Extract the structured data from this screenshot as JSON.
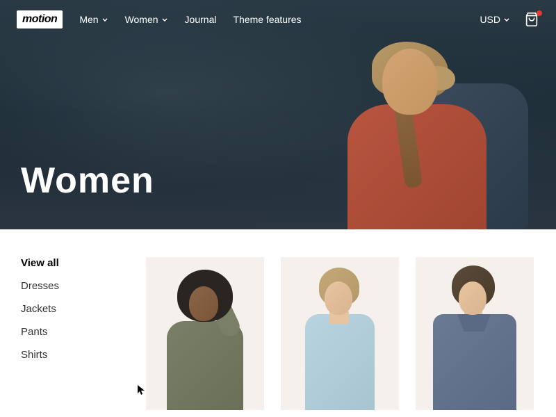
{
  "header": {
    "logo": "motion",
    "nav": [
      {
        "label": "Men",
        "hasDropdown": true
      },
      {
        "label": "Women",
        "hasDropdown": true
      },
      {
        "label": "Journal",
        "hasDropdown": false
      },
      {
        "label": "Theme features",
        "hasDropdown": false
      }
    ],
    "currency": "USD"
  },
  "hero": {
    "title": "Women"
  },
  "sidebar": {
    "items": [
      {
        "label": "View all",
        "active": true
      },
      {
        "label": "Dresses",
        "active": false
      },
      {
        "label": "Jackets",
        "active": false
      },
      {
        "label": "Pants",
        "active": false
      },
      {
        "label": "Shirts",
        "active": false
      }
    ]
  }
}
